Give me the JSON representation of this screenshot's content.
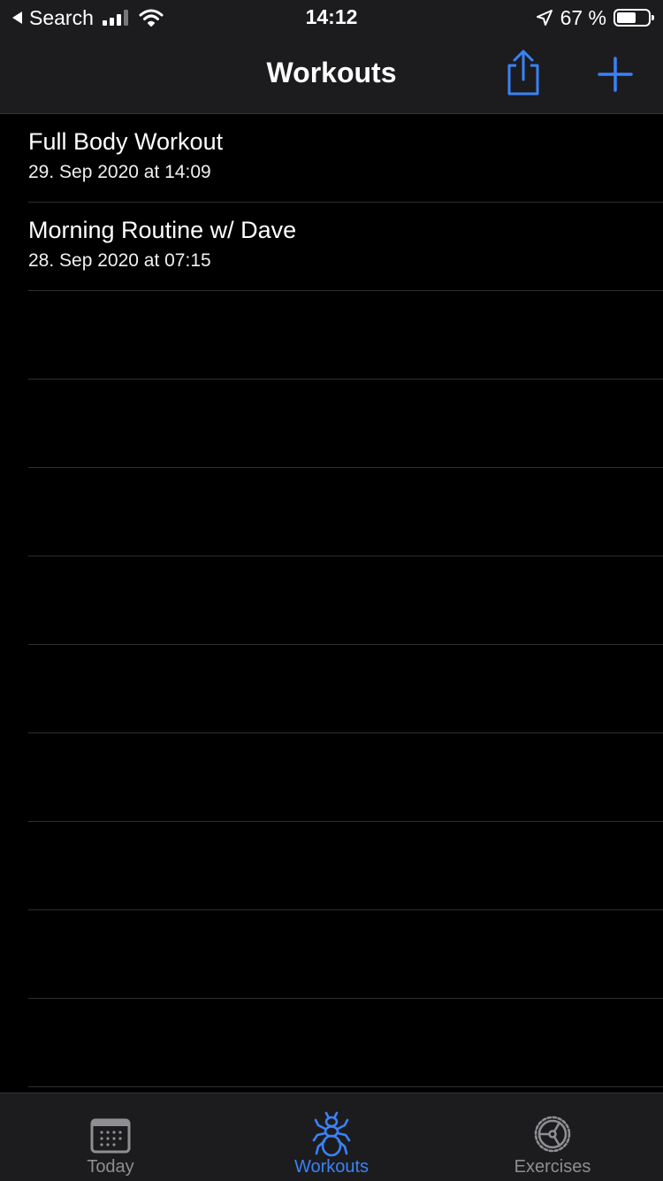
{
  "status": {
    "back_label": "Search",
    "time": "14:12",
    "battery": "67 %",
    "battery_level": 0.67
  },
  "nav": {
    "title": "Workouts",
    "share_icon": "share-icon",
    "add_icon": "plus-icon"
  },
  "workouts": [
    {
      "title": "Full Body Workout",
      "date": "29. Sep 2020 at 14:09"
    },
    {
      "title": "Morning Routine w/ Dave",
      "date": "28. Sep 2020 at 07:15"
    }
  ],
  "tabs": [
    {
      "label": "Today",
      "icon": "calendar-icon",
      "active": false
    },
    {
      "label": "Workouts",
      "icon": "ant-icon",
      "active": true
    },
    {
      "label": "Exercises",
      "icon": "gear-icon",
      "active": false
    }
  ],
  "colors": {
    "accent": "#3a82f7",
    "background": "#000000",
    "bar": "#1c1c1e",
    "inactive": "#8e8e93"
  }
}
